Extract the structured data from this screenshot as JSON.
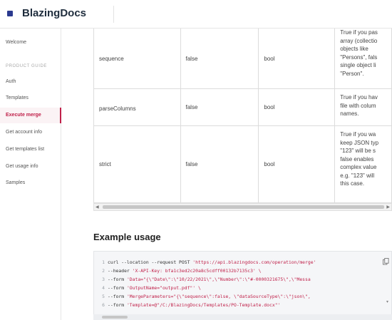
{
  "brand": {
    "name": "BlazingDocs"
  },
  "sidebar": {
    "welcome": "Welcome",
    "section": "PRODUCT GUIDE",
    "items": [
      "Auth",
      "Templates",
      "Execute merge",
      "Get account info",
      "Get templates list",
      "Get usage info",
      "Samples"
    ],
    "active": "Execute merge"
  },
  "params_table": {
    "rows": [
      {
        "name": "sequence",
        "default": "false",
        "type": "bool",
        "desc": [
          "True if you pas",
          "array (collectio",
          "objects like",
          "\"Persons\", fals",
          "single object li",
          "\"Person\"."
        ]
      },
      {
        "name": "parseColumns",
        "default": "false",
        "type": "bool",
        "desc": [
          "True if you hav",
          "file with colum",
          "names."
        ]
      },
      {
        "name": "strict",
        "default": "false",
        "type": "bool",
        "desc": [
          "True if you wa",
          "keep JSON typ",
          "\"123\" will be s",
          "false enables",
          "complex value",
          "e.g. \"123\" will",
          "this case."
        ]
      }
    ]
  },
  "example": {
    "title": "Example usage",
    "lines": [
      {
        "n": "1",
        "code": "curl --location --request POST ",
        "str": "'https://api.blazingdocs.com/operation/merge'"
      },
      {
        "n": "2",
        "code": "--header ",
        "str": "'X-API-Key: bfa1c3ed2c20a8c5cdff00132b7135c3' \\"
      },
      {
        "n": "3",
        "code": "--form ",
        "str": "'Data=\"{\\\"Date\\\":\\\"10/22/2021\\\",\\\"Number\\\":\\\"#-0000321675\\\",\\\"Messa"
      },
      {
        "n": "4",
        "code": "--form ",
        "str": "'OutputName=\"output.pdf\"' \\"
      },
      {
        "n": "5",
        "code": "--form ",
        "str": "'MergeParameters=\"{\\\"sequence\\\":false, \\\"dataSourceType\\\":\\\"json\\\","
      },
      {
        "n": "6",
        "code": "--form ",
        "str": "'Template=@\"/C:/BlazingDocs/Templates/PO-Template.docx\"'"
      }
    ]
  }
}
